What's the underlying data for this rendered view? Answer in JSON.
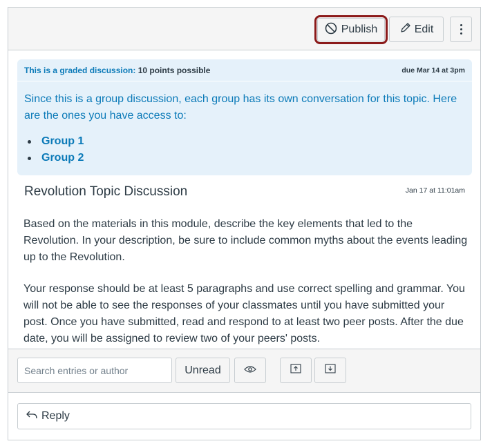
{
  "toolbar": {
    "publish_label": "Publish",
    "edit_label": "Edit"
  },
  "graded": {
    "label": "This is a graded discussion:",
    "points": "10 points possible",
    "due": "due Mar 14 at 3pm",
    "group_intro": "Since this is a group discussion, each group has its own conversation for this topic. Here are the ones you have access to:",
    "groups": [
      "Group 1",
      "Group 2"
    ]
  },
  "topic": {
    "title": "Revolution Topic Discussion",
    "date": "Jan 17 at 11:01am",
    "paragraphs": [
      "Based on the materials in this module, describe the key elements that led to the Revolution. In your description, be sure to include common myths about the events leading up to the Revolution.",
      "Your response should be at least 5 paragraphs and use correct spelling and grammar. You will not be able to see the responses of your classmates until you have submitted your post. Once you have submitted, read and respond to at least two peer posts. After the due date, you will be assigned to review two of your peers' posts."
    ]
  },
  "search": {
    "placeholder": "Search entries or author",
    "unread_label": "Unread"
  },
  "reply": {
    "label": "Reply"
  },
  "icons": {
    "publish": "unpublished-circle-slash-icon",
    "edit": "pencil-icon",
    "more": "kebab-vertical-icon",
    "eye": "eye-icon",
    "expand": "collapse-up-icon",
    "collapse": "expand-down-icon",
    "reply": "reply-arrow-icon"
  },
  "colors": {
    "accent": "#0b7ab8",
    "panel_bg": "#e5f1fa",
    "highlight": "#8b1a1a",
    "text": "#2d3b45"
  }
}
